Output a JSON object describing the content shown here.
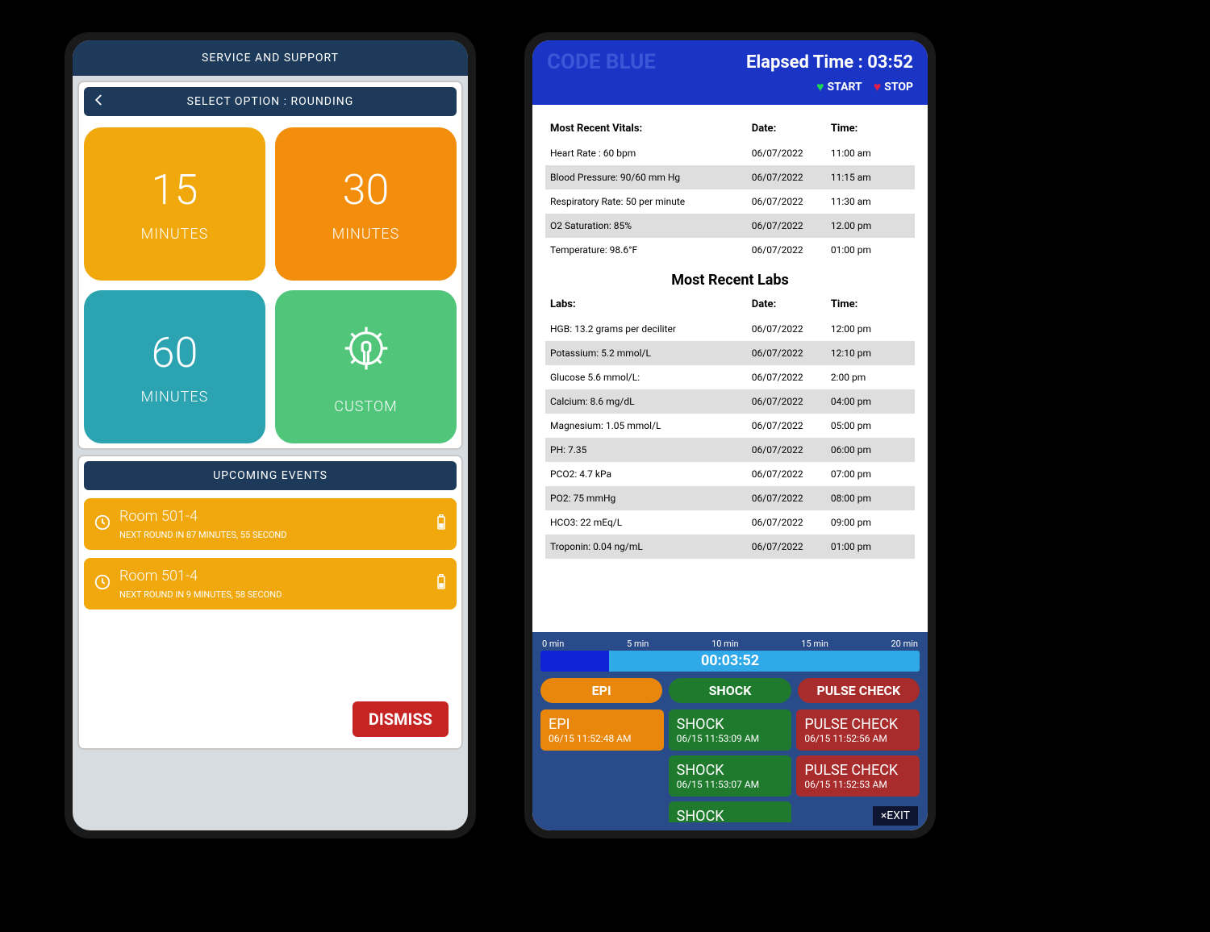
{
  "left": {
    "header": "SERVICE AND SUPPORT",
    "select_bar": "SELECT OPTION : ROUNDING",
    "tiles": {
      "t15_num": "15",
      "t15_lbl": "MINUTES",
      "t30_num": "30",
      "t30_lbl": "MINUTES",
      "t60_num": "60",
      "t60_lbl": "MINUTES",
      "custom_lbl": "CUSTOM"
    },
    "events_header": "UPCOMING EVENTS",
    "events": [
      {
        "room": "Room 501-4",
        "next": "NEXT ROUND IN 87 MINUTES, 55 SECOND"
      },
      {
        "room": "Room 501-4",
        "next": "NEXT ROUND IN 9 MINUTES, 58 SECOND"
      }
    ],
    "dismiss": "DISMISS"
  },
  "right": {
    "code_blue": "CODE BLUE",
    "elapsed_label": "Elapsed Time : 03:52",
    "start": "START",
    "stop": "STOP",
    "vitals_header": {
      "c1": "Most Recent Vitals:",
      "c2": "Date:",
      "c3": "Time:"
    },
    "vitals": [
      {
        "c1": "Heart Rate : 60 bpm",
        "c2": "06/07/2022",
        "c3": "11:00 am"
      },
      {
        "c1": "Blood Pressure: 90/60 mm Hg",
        "c2": "06/07/2022",
        "c3": "11:15 am"
      },
      {
        "c1": "Respiratory Rate: 50 per minute",
        "c2": "06/07/2022",
        "c3": "11:30 am"
      },
      {
        "c1": "O2 Saturation: 85%",
        "c2": "06/07/2022",
        "c3": "12.00 pm"
      },
      {
        "c1": "Temperature: 98.6°F",
        "c2": "06/07/2022",
        "c3": "01:00 pm"
      }
    ],
    "labs_title": "Most Recent Labs",
    "labs_header": {
      "c1": "Labs:",
      "c2": "Date:",
      "c3": "Time:"
    },
    "labs": [
      {
        "c1": "HGB: 13.2 grams per deciliter",
        "c2": "06/07/2022",
        "c3": "12:00 pm"
      },
      {
        "c1": "Potassium: 5.2 mmol/L",
        "c2": "06/07/2022",
        "c3": "12:10 pm"
      },
      {
        "c1": "Glucose 5.6 mmol/L:",
        "c2": "06/07/2022",
        "c3": "2:00 pm"
      },
      {
        "c1": "Calcium: 8.6 mg/dL",
        "c2": "06/07/2022",
        "c3": "04:00 pm"
      },
      {
        "c1": "Magnesium: 1.05 mmol/L",
        "c2": "06/07/2022",
        "c3": "05:00 pm"
      },
      {
        "c1": "PH: 7.35",
        "c2": "06/07/2022",
        "c3": "06:00 pm"
      },
      {
        "c1": "PCO2: 4.7 kPa",
        "c2": "06/07/2022",
        "c3": "07:00 pm"
      },
      {
        "c1": "PO2: 75 mmHg",
        "c2": "06/07/2022",
        "c3": "08:00 pm"
      },
      {
        "c1": "HCO3: 22 mEq/L",
        "c2": "06/07/2022",
        "c3": "09:00 pm"
      },
      {
        "c1": "Troponin: 0.04 ng/mL",
        "c2": "06/07/2022",
        "c3": "01:00 pm"
      }
    ],
    "progress": {
      "ticks": [
        "0 min",
        "5 min",
        "10 min",
        "15 min",
        "20 min"
      ],
      "label": "00:03:52",
      "pills": {
        "epi": "EPI",
        "shock": "SHOCK",
        "pulse": "PULSE CHECK"
      }
    },
    "logs": [
      {
        "t": "EPI",
        "s": "06/15 11:52:48 AM",
        "cls": "p-orange"
      },
      {
        "t": "SHOCK",
        "s": "06/15 11:53:09 AM",
        "cls": "p-green"
      },
      {
        "t": "PULSE CHECK",
        "s": "06/15 11:52:56 AM",
        "cls": "p-red"
      },
      {
        "t": "",
        "s": "",
        "cls": ""
      },
      {
        "t": "SHOCK",
        "s": "06/15 11:53:07 AM",
        "cls": "p-green"
      },
      {
        "t": "PULSE CHECK",
        "s": "06/15 11:52:53 AM",
        "cls": "p-red"
      },
      {
        "t": "",
        "s": "",
        "cls": ""
      },
      {
        "t": "SHOCK",
        "s": "",
        "cls": "p-green"
      }
    ],
    "exit": "×EXIT"
  }
}
